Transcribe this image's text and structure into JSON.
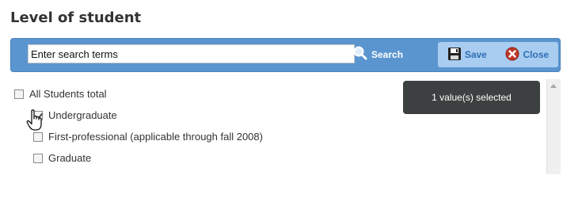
{
  "page": {
    "title": "Level of student"
  },
  "search": {
    "placeholder": "Enter search terms",
    "button_label": "Search"
  },
  "actions": {
    "save_label": "Save",
    "close_label": "Close"
  },
  "list": {
    "items": [
      {
        "label": "All Students total",
        "checked": false
      },
      {
        "label": "Undergraduate",
        "checked": true
      },
      {
        "label": "First-professional (applicable through fall 2008)",
        "checked": false
      },
      {
        "label": "Graduate",
        "checked": false
      }
    ]
  },
  "tooltip": {
    "text": "1 value(s) selected"
  },
  "colors": {
    "bar": "#5b95d0",
    "action_group": "#a9cdf0",
    "tooltip_bg": "#3d4040"
  }
}
